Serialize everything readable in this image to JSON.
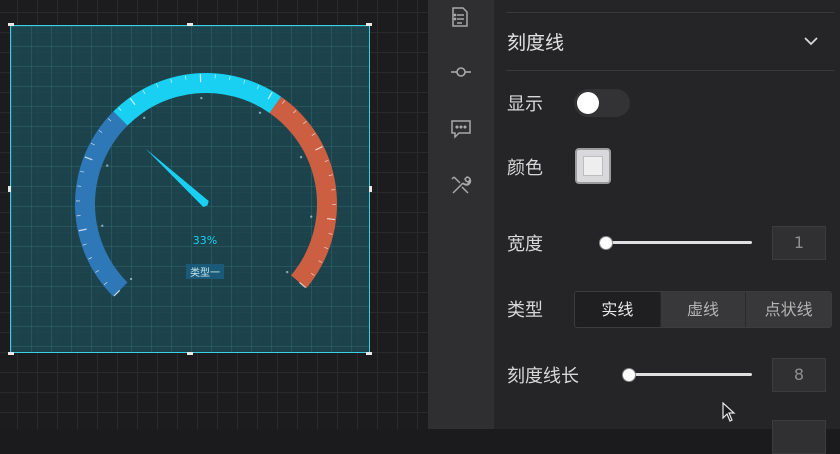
{
  "gauge": {
    "percent_label": "33%",
    "value_fraction": 0.33,
    "name_badge": "类型一",
    "colors": {
      "segment_blue": "#2f78b8",
      "segment_cyan": "#1ad0f2",
      "segment_red": "#cc5f42",
      "pointer": "#1ad0f2",
      "selection_border": "#39d0e8"
    }
  },
  "rail": {
    "icons": [
      "list-file-icon",
      "commit-node-icon",
      "chat-bubble-icon",
      "tools-icon"
    ]
  },
  "panel": {
    "section_title": "刻度线",
    "show": {
      "label": "显示",
      "enabled": false
    },
    "color": {
      "label": "颜色",
      "value": "#eeeeee"
    },
    "width": {
      "label": "宽度",
      "value": "1",
      "fraction": 0.0
    },
    "type": {
      "label": "类型",
      "options": [
        "实线",
        "虚线",
        "点状线"
      ],
      "selected": "实线"
    },
    "tick_length": {
      "label": "刻度线长",
      "value": "8",
      "fraction": 0.0
    }
  }
}
